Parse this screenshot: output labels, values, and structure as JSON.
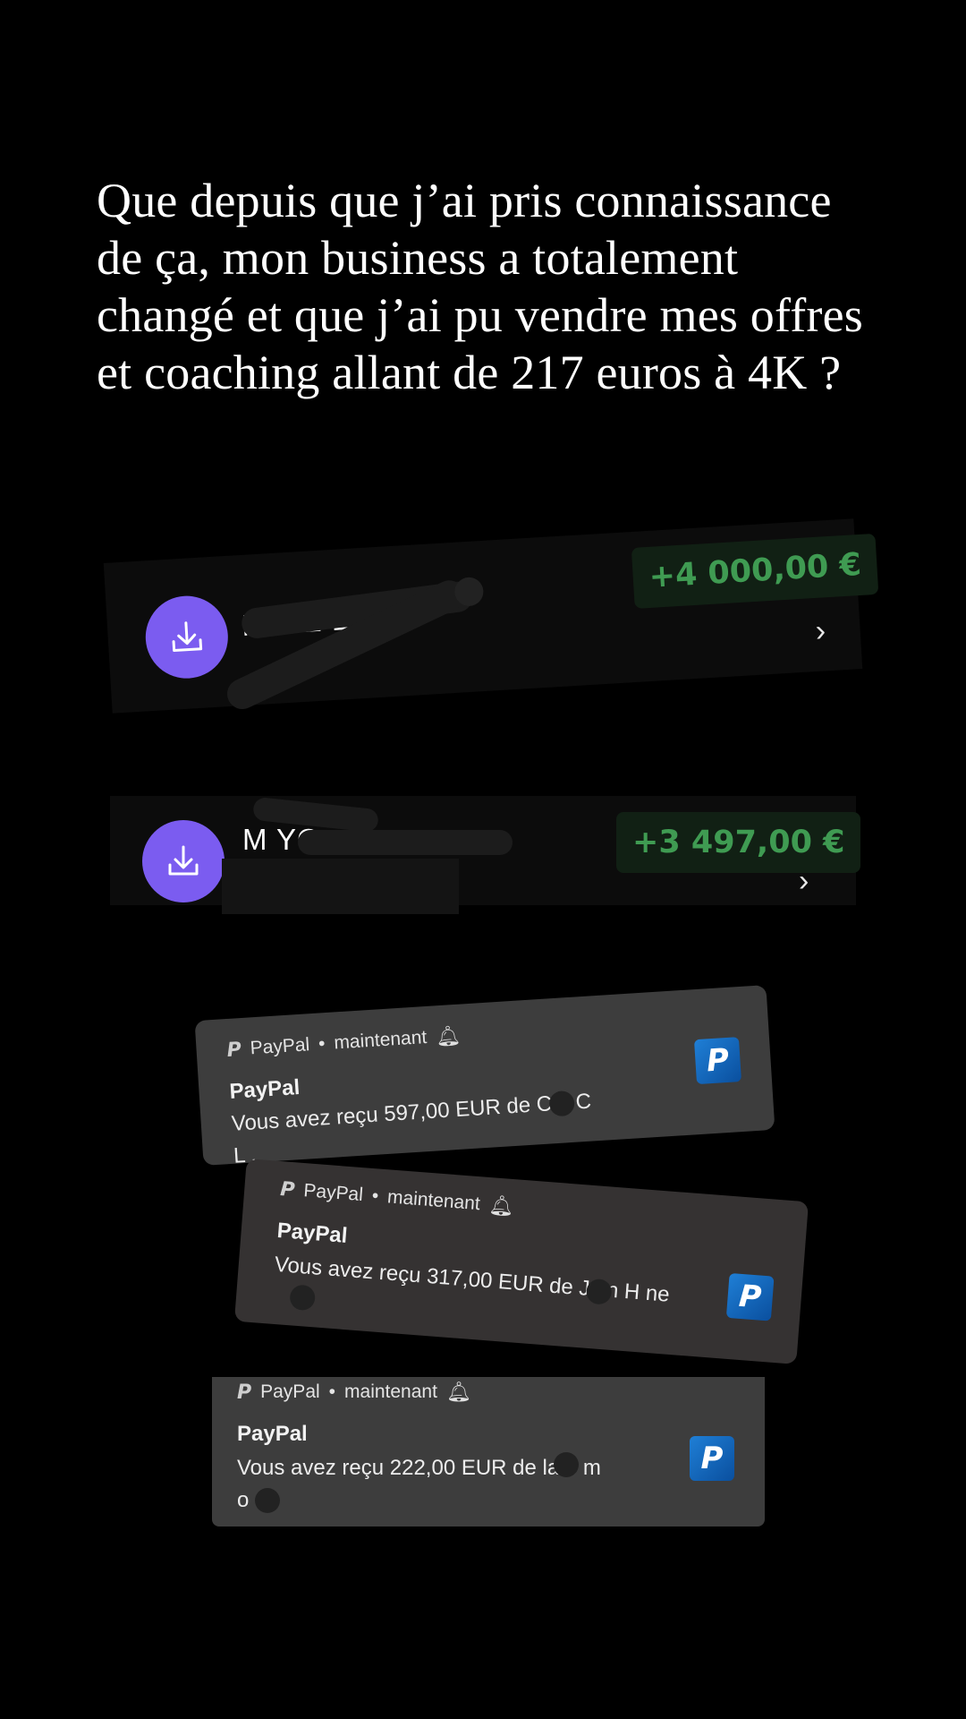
{
  "headline": "Que depuis que j’ai pris connaissance de ça, mon business a totalement changé et que j’ai pu vendre mes offres et coaching allant de 217 euros à 4K ?",
  "transactions": [
    {
      "name": "MLLE E   E",
      "amount": "+4 000,00 €"
    },
    {
      "name": "M YO",
      "amount": "+3 497,00 €"
    }
  ],
  "notifications": [
    {
      "app": "PayPal",
      "time": "maintenant",
      "separator": "•",
      "title": "PayPal",
      "message": "Vous avez reçu 597,00 EUR de C   a C  L   ."
    },
    {
      "app": "PayPal",
      "time": "maintenant",
      "separator": "•",
      "title": "PayPal",
      "message": "Vous avez reçu 317,00 EUR de J   tin H   ne"
    },
    {
      "app": "PayPal",
      "time": "maintenant",
      "separator": "•",
      "title": "PayPal",
      "message": "Vous avez reçu 222,00 EUR de la   e m   o"
    }
  ],
  "icons": {
    "download": "download-icon",
    "chevron": "chevron-right-icon",
    "bell": "bell-icon",
    "paypal": "paypal-logo-icon"
  },
  "colors": {
    "background": "#000000",
    "accent_purple": "#7b5cf0",
    "amount_green": "#3f9b52",
    "notification_bg": "#3d3d3d",
    "paypal_blue": "#1f7fd6"
  }
}
